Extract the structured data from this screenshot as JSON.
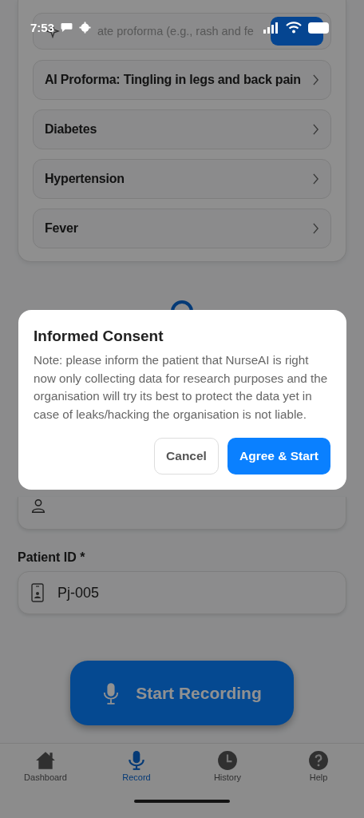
{
  "status_bar": {
    "time": "7:53"
  },
  "proforma_card": {
    "create_field": {
      "placeholder": "ate proforma (e.g., rash and fe"
    },
    "items": [
      "AI Proforma: Tingling in legs and back pain",
      "Diabetes",
      "Hypertension",
      "Fever"
    ]
  },
  "patient_id": {
    "label": "Patient ID *",
    "value": "Pj-005"
  },
  "record_button": "Start Recording",
  "dialog": {
    "title": "Informed Consent",
    "message": "Note: please inform the patient that NurseAI is right now only collecting data for research purposes and the organisation will try its best to protect the data yet in case of leaks/hacking the organisation is not liable.",
    "buttons": [
      {
        "label": "Cancel",
        "kind": "secondary"
      },
      {
        "label": "Agree & Start",
        "kind": "primary"
      }
    ]
  },
  "nav": [
    {
      "label": "Dashboard",
      "selected": false
    },
    {
      "label": "Record",
      "selected": true
    },
    {
      "label": "History",
      "selected": false
    },
    {
      "label": "Help",
      "selected": false
    }
  ]
}
